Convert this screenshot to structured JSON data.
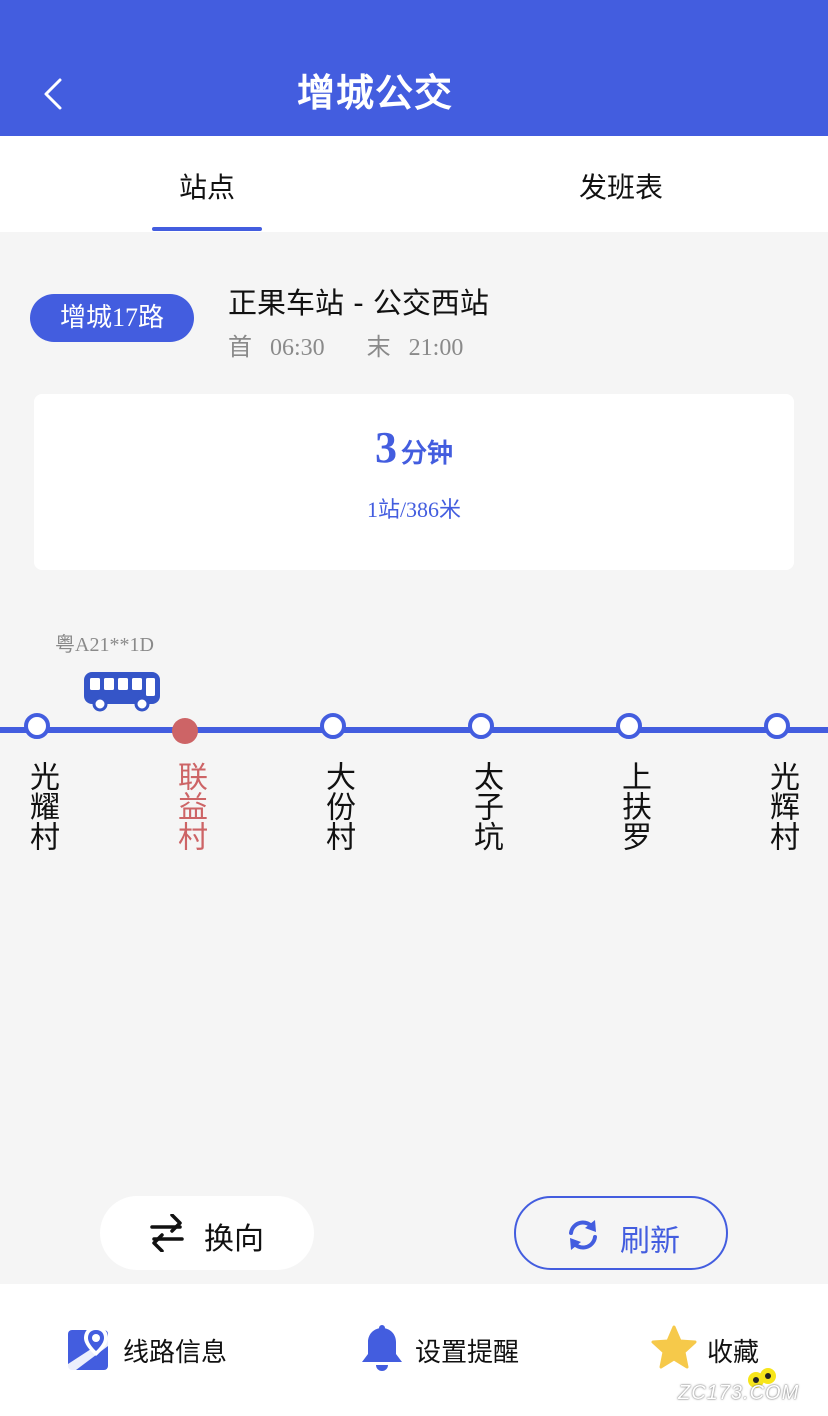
{
  "header": {
    "title": "增城公交",
    "back_icon": "chevron-left-icon"
  },
  "tabs": [
    {
      "label": "站点",
      "active": true
    },
    {
      "label": "发班表",
      "active": false
    }
  ],
  "route": {
    "badge": "增城17路",
    "name": "正果车站 - 公交西站",
    "first_label": "首",
    "first_time": "06:30",
    "last_label": "末",
    "last_time": "21:00"
  },
  "eta": {
    "minutes": "3",
    "unit": "分钟",
    "detail": "1站/386米"
  },
  "bus": {
    "plate": "粤A21**1D",
    "icon": "bus-icon"
  },
  "stops": [
    {
      "name": "光耀村",
      "current": false
    },
    {
      "name": "联益村",
      "current": true
    },
    {
      "name": "大份村",
      "current": false
    },
    {
      "name": "太子坑",
      "current": false
    },
    {
      "name": "上扶罗",
      "current": false
    },
    {
      "name": "光辉村",
      "current": false
    }
  ],
  "actions": {
    "reverse_label": "换向",
    "refresh_label": "刷新"
  },
  "bottom": {
    "route_info_label": "线路信息",
    "reminder_label": "设置提醒",
    "favorite_label": "收藏"
  },
  "watermark": {
    "text": "ZC173.COM"
  },
  "colors": {
    "primary": "#435ddf",
    "current_stop": "#cd6466",
    "favorite_star": "#f6c94a",
    "background": "#f5f5f5"
  }
}
